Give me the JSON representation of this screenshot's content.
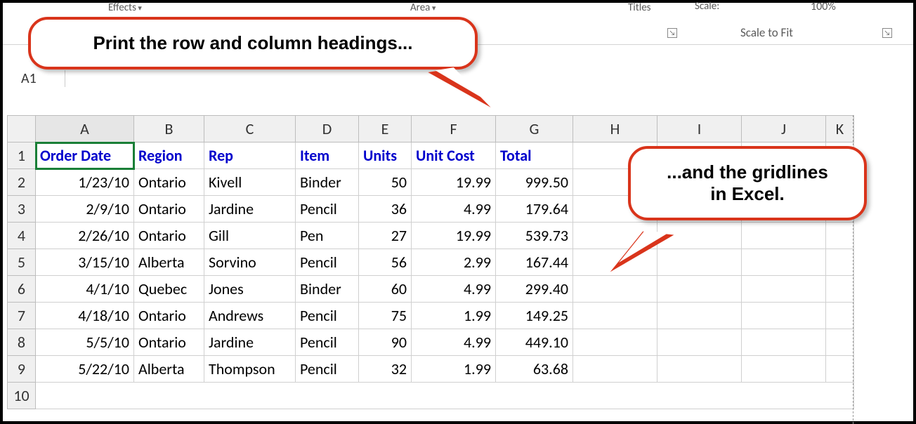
{
  "ribbon": {
    "effects": "Effects",
    "area": "Area",
    "titles": "Titles",
    "scale_label": "Scale:",
    "scale_value": "100%",
    "scale_to_fit": "Scale to Fit"
  },
  "name_box": "A1",
  "columns": [
    "A",
    "B",
    "C",
    "D",
    "E",
    "F",
    "G",
    "H",
    "I",
    "J",
    "K"
  ],
  "col_widths": [
    "col-A",
    "col-B",
    "col-C",
    "col-D",
    "col-E",
    "col-F",
    "col-G",
    "col-H",
    "col-I",
    "col-J",
    "col-K"
  ],
  "headers_row": [
    "Order Date",
    "Region",
    "Rep",
    "Item",
    "Units",
    "Unit Cost",
    "Total"
  ],
  "rows": [
    {
      "n": 2,
      "cells": [
        "1/23/10",
        "Ontario",
        "Kivell",
        "Binder",
        "50",
        "19.99",
        "999.50"
      ]
    },
    {
      "n": 3,
      "cells": [
        "2/9/10",
        "Ontario",
        "Jardine",
        "Pencil",
        "36",
        "4.99",
        "179.64"
      ]
    },
    {
      "n": 4,
      "cells": [
        "2/26/10",
        "Ontario",
        "Gill",
        "Pen",
        "27",
        "19.99",
        "539.73"
      ]
    },
    {
      "n": 5,
      "cells": [
        "3/15/10",
        "Alberta",
        "Sorvino",
        "Pencil",
        "56",
        "2.99",
        "167.44"
      ]
    },
    {
      "n": 6,
      "cells": [
        "4/1/10",
        "Quebec",
        "Jones",
        "Binder",
        "60",
        "4.99",
        "299.40"
      ]
    },
    {
      "n": 7,
      "cells": [
        "4/18/10",
        "Ontario",
        "Andrews",
        "Pencil",
        "75",
        "1.99",
        "149.25"
      ]
    },
    {
      "n": 8,
      "cells": [
        "5/5/10",
        "Ontario",
        "Jardine",
        "Pencil",
        "90",
        "4.99",
        "449.10"
      ]
    },
    {
      "n": 9,
      "cells": [
        "5/22/10",
        "Alberta",
        "Thompson",
        "Pencil",
        "32",
        "1.99",
        "63.68"
      ]
    }
  ],
  "row_align": [
    "num",
    "txt",
    "txt",
    "txt",
    "num",
    "num",
    "num"
  ],
  "extra_row_label": "10",
  "callout1": "Print the row and column headings...",
  "callout2_line1": "...and the gridlines",
  "callout2_line2": "in Excel.",
  "chart_data": {
    "type": "table",
    "columns": [
      "Order Date",
      "Region",
      "Rep",
      "Item",
      "Units",
      "Unit Cost",
      "Total"
    ],
    "rows": [
      [
        "1/23/10",
        "Ontario",
        "Kivell",
        "Binder",
        50,
        19.99,
        999.5
      ],
      [
        "2/9/10",
        "Ontario",
        "Jardine",
        "Pencil",
        36,
        4.99,
        179.64
      ],
      [
        "2/26/10",
        "Ontario",
        "Gill",
        "Pen",
        27,
        19.99,
        539.73
      ],
      [
        "3/15/10",
        "Alberta",
        "Sorvino",
        "Pencil",
        56,
        2.99,
        167.44
      ],
      [
        "4/1/10",
        "Quebec",
        "Jones",
        "Binder",
        60,
        4.99,
        299.4
      ],
      [
        "4/18/10",
        "Ontario",
        "Andrews",
        "Pencil",
        75,
        1.99,
        149.25
      ],
      [
        "5/5/10",
        "Ontario",
        "Jardine",
        "Pencil",
        90,
        4.99,
        449.1
      ],
      [
        "5/22/10",
        "Alberta",
        "Thompson",
        "Pencil",
        32,
        1.99,
        63.68
      ]
    ]
  }
}
